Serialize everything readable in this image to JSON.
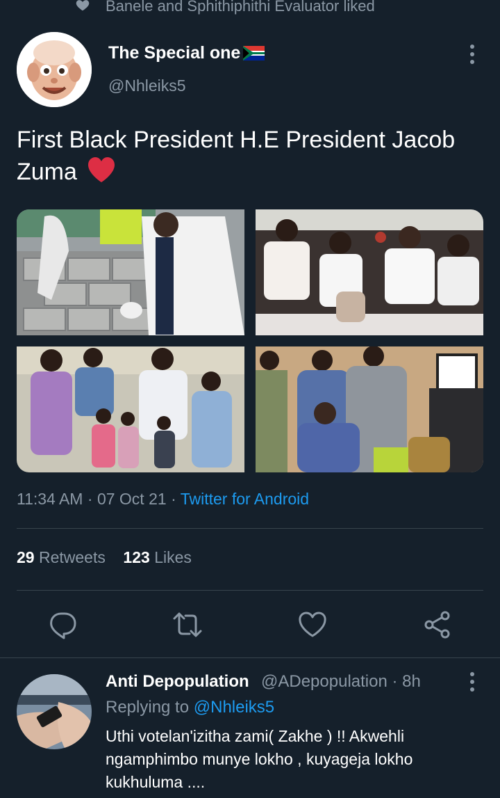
{
  "social_context": {
    "text": "Banele and Sphithiphithi Evaluator liked",
    "icon": "heart-icon"
  },
  "tweet": {
    "author_name": "The Special one",
    "author_flag": "south-africa-flag-emoji",
    "author_handle": "@Nhleiks5",
    "text": "First Black President H.E President Jacob Zuma",
    "text_emoji": "red-heart-emoji",
    "media": [
      {
        "name": "photo-bricklaying",
        "description_icon": "photo"
      },
      {
        "name": "photo-youth-event",
        "description_icon": "photo"
      },
      {
        "name": "photo-family-group",
        "description_icon": "photo"
      },
      {
        "name": "photo-elderly-visit",
        "description_icon": "photo"
      }
    ],
    "time": "11:34 AM",
    "date": "07 Oct 21",
    "separator": "·",
    "source": "Twitter for Android",
    "retweets_count": "29",
    "retweets_label": "Retweets",
    "likes_count": "123",
    "likes_label": "Likes",
    "actions": [
      "reply-icon",
      "retweet-icon",
      "like-icon",
      "share-icon"
    ]
  },
  "reply": {
    "author_name": "Anti Depopulation",
    "author_handle": "@ADepopulation",
    "time": "· 8h",
    "replying_to_label": "Replying to",
    "replying_to_handle": "@Nhleiks5",
    "text": "Uthi votelan'izitha zami( Zakhe ) !!  Akwehli ngamphimbo munye lokho , kuyageja lokho kukhuluma ...."
  },
  "colors": {
    "background": "#15202b",
    "text_primary": "#ffffff",
    "text_secondary": "#8b98a5",
    "link": "#1d9bf0",
    "divider": "#38444d"
  }
}
